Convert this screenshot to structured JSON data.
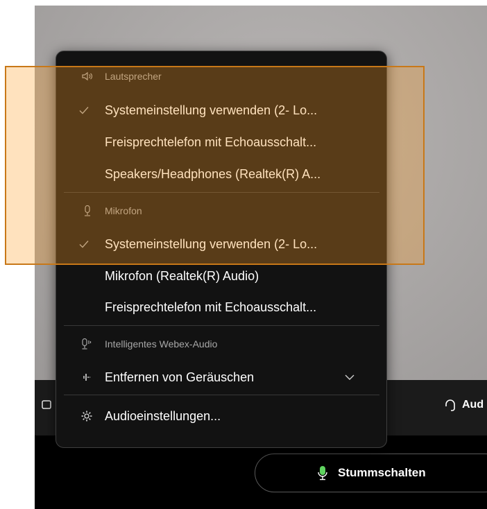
{
  "menu": {
    "speaker_section": {
      "title": "Lautsprecher",
      "icon": "speaker-icon",
      "items": [
        {
          "label": "Systemeinstellung verwenden (2- Lo...",
          "checked": true
        },
        {
          "label": "Freisprechtelefon mit Echoausschalt...",
          "checked": false
        },
        {
          "label": "Speakers/Headphones (Realtek(R) A...",
          "checked": false
        }
      ]
    },
    "mic_section": {
      "title": "Mikrofon",
      "icon": "microphone-icon",
      "items": [
        {
          "label": "Systemeinstellung verwenden (2- Lo...",
          "checked": true
        },
        {
          "label": "Mikrofon (Realtek(R) Audio)",
          "checked": false
        },
        {
          "label": "Freisprechtelefon mit Echoausschalt...",
          "checked": false
        }
      ]
    },
    "smart_audio_section": {
      "title": "Intelligentes Webex-Audio",
      "icon": "smart-audio-icon",
      "noise_removal_label": "Entfernen von Geräuschen"
    },
    "audio_settings_label": "Audioeinstellungen..."
  },
  "toolbar": {
    "audio_label": "Aud",
    "mute_label": "Stummschalten"
  },
  "colors": {
    "menu_bg": "#121212",
    "highlight_border": "#c87818",
    "highlight_fill": "rgba(255,160,40,0.30)"
  }
}
